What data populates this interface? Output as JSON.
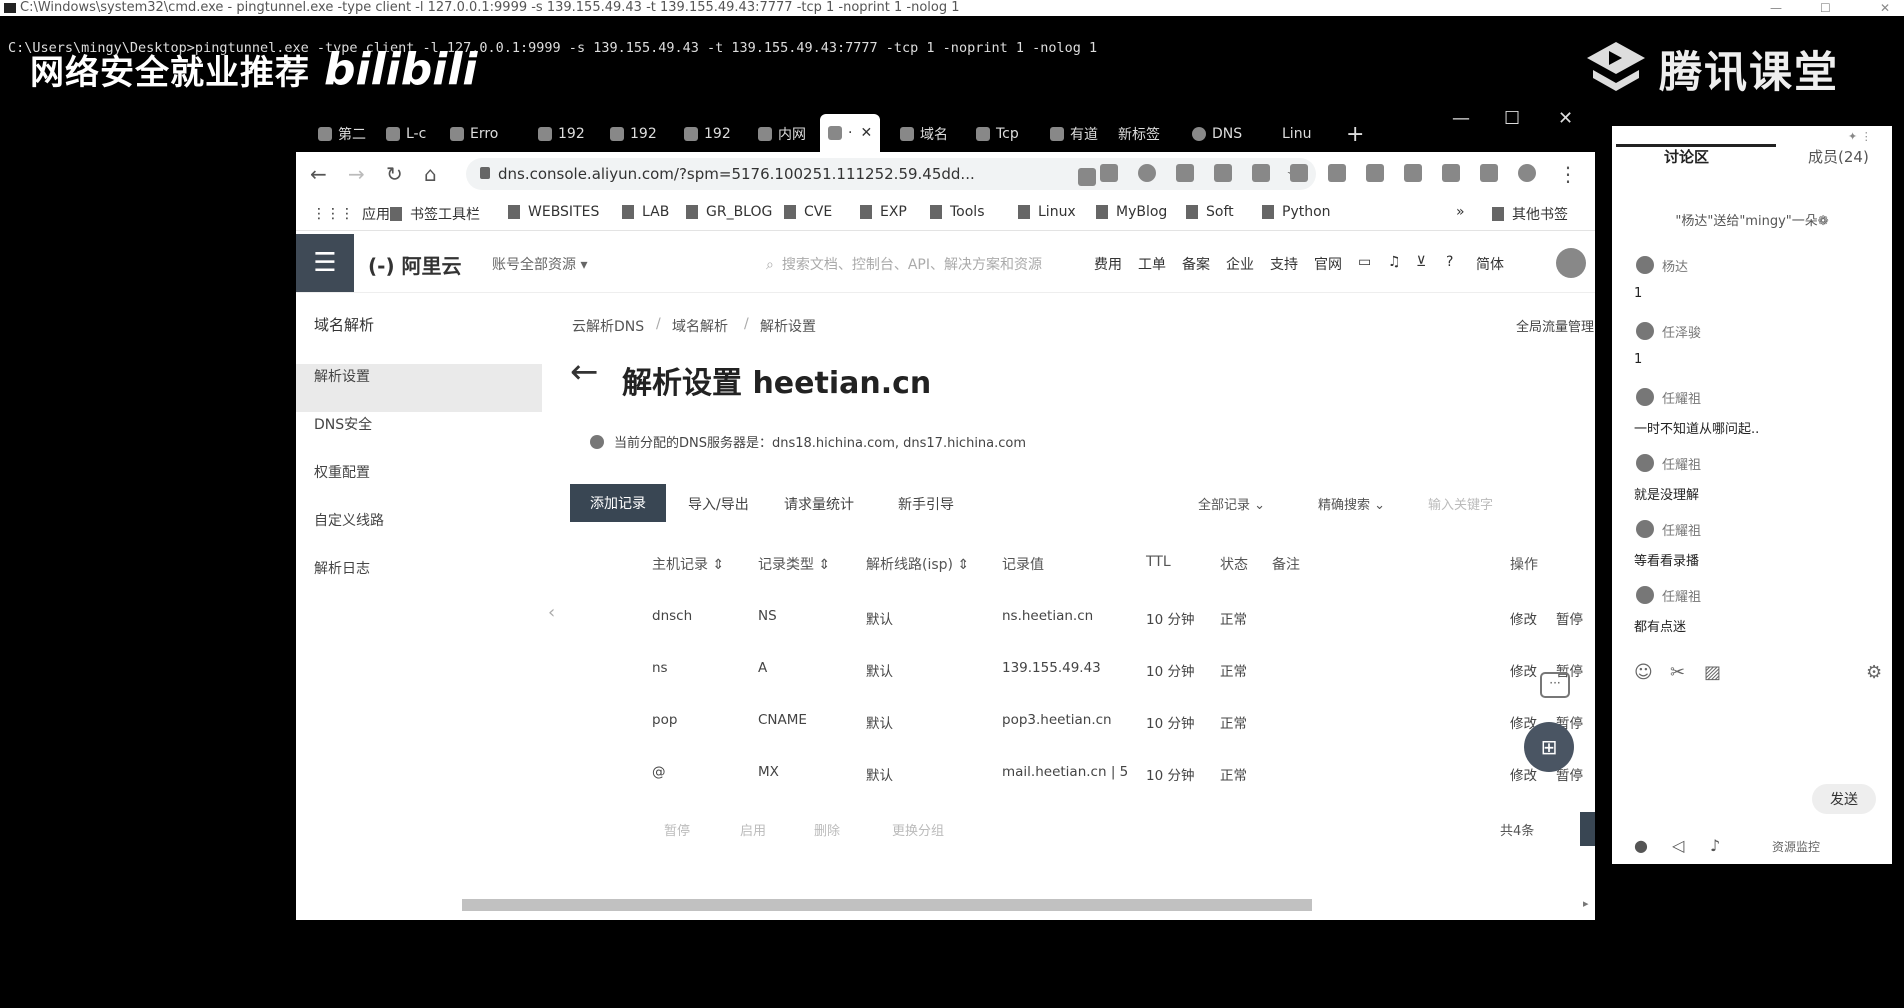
{
  "cmd": {
    "title": "C:\\Windows\\system32\\cmd.exe - pingtunnel.exe  -type client -l 127.0.0.1:9999 -s 139.155.49.43 -t 139.155.49.43:7777 -tcp 1 -noprint 1 -nolog 1",
    "line": "C:\\Users\\mingy\\Desktop>pingtunnel.exe -type client -l 127.0.0.1:9999 -s 139.155.49.43 -t 139.155.49.43:7777 -tcp 1 -noprint 1 -nolog 1"
  },
  "overlay": {
    "left_text": "网络安全就业推荐",
    "bili": "bilibili",
    "tencent": "腾讯课堂"
  },
  "browser": {
    "tabs": [
      "第二",
      "L-c",
      "Erro",
      "192",
      "192",
      "192",
      "内网",
      "·",
      "域名",
      "Tcp",
      "有道",
      "新标签",
      "DNS",
      "Linu"
    ],
    "new_tab": "+",
    "window_controls": [
      "—",
      "☐",
      "✕"
    ],
    "url": "dns.console.aliyun.com/?spm=5176.100251.111252.59.45dd...",
    "bookmarks": [
      "应用",
      "书签工具栏",
      "WEBSITES",
      "LAB",
      "GR_BLOG",
      "CVE",
      "EXP",
      "Tools",
      "Linux",
      "MyBlog",
      "Soft",
      "Python"
    ],
    "bookmark_more": "»",
    "other_bookmarks": "其他书签"
  },
  "aliyun": {
    "logo": "(-) 阿里云",
    "account": "账号全部资源 ▾",
    "search_placeholder": "搜索文档、控制台、API、解决方案和资源",
    "topnav": [
      "费用",
      "工单",
      "备案",
      "企业",
      "支持",
      "官网"
    ],
    "lang": "简体",
    "sidebar": {
      "title": "域名解析",
      "items": [
        "解析设置",
        "DNS安全",
        "权重配置",
        "自定义线路",
        "解析日志"
      ]
    },
    "breadcrumb": [
      "云解析DNS",
      "/",
      "域名解析",
      "/",
      "解析设置"
    ],
    "right_link": "全局流量管理",
    "page_title": "解析设置 heetian.cn",
    "notice": "当前分配的DNS服务器是：dns18.hichina.com, dns17.hichina.com",
    "buttons": {
      "add": "添加记录",
      "import": "导入/导出",
      "stats": "请求量统计",
      "guide": "新手引导"
    },
    "filters": {
      "all": "全部记录 ⌄",
      "precise": "精确搜索 ⌄",
      "keyword_placeholder": "输入关键字"
    },
    "columns": [
      "主机记录 ⇕",
      "记录类型 ⇕",
      "解析线路(isp) ⇕",
      "记录值",
      "TTL",
      "状态",
      "备注",
      "操作"
    ],
    "rows": [
      {
        "host": "dnsch",
        "type": "NS",
        "line": "默认",
        "value": "ns.heetian.cn",
        "ttl": "10 分钟",
        "status": "正常",
        "edit": "修改",
        "pause": "暂停"
      },
      {
        "host": "ns",
        "type": "A",
        "line": "默认",
        "value": "139.155.49.43",
        "ttl": "10 分钟",
        "status": "正常",
        "edit": "修改",
        "pause": "暂停"
      },
      {
        "host": "pop",
        "type": "CNAME",
        "line": "默认",
        "value": "pop3.heetian.cn",
        "ttl": "10 分钟",
        "status": "正常",
        "edit": "修改",
        "pause": "暂停"
      },
      {
        "host": "@",
        "type": "MX",
        "line": "默认",
        "value": "mail.heetian.cn | 5",
        "ttl": "10 分钟",
        "status": "正常",
        "edit": "修改",
        "pause": "暂停"
      }
    ],
    "bulk": [
      "暂停",
      "启用",
      "删除",
      "更换分组"
    ],
    "total": "共4条"
  },
  "panel": {
    "tab_discuss": "讨论区",
    "tab_members": "成员(24)",
    "gift": "\"杨达\"送给\"mingy\"一朵❁",
    "messages": [
      {
        "name": "杨达",
        "text": "1"
      },
      {
        "name": "任泽骏",
        "text": "1"
      },
      {
        "name": "任耀祖",
        "text": "一时不知道从哪问起.."
      },
      {
        "name": "任耀祖",
        "text": "就是没理解"
      },
      {
        "name": "任耀祖",
        "text": "等看看录播"
      },
      {
        "name": "任耀祖",
        "text": "都有点迷"
      }
    ],
    "send": "发送",
    "resource_monitor": "资源监控"
  }
}
